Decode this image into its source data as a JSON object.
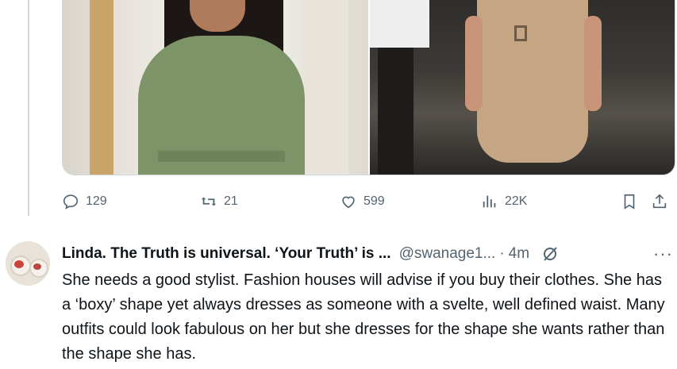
{
  "media": {
    "images": [
      {
        "icon": "woman-in-green-shirt-dress-photo"
      },
      {
        "icon": "woman-in-beige-trench-dress-photo"
      }
    ]
  },
  "actions": {
    "replies": "129",
    "reposts": "21",
    "likes": "599",
    "views": "22K"
  },
  "reply": {
    "display_name": "Linda. The Truth is universal. ‘Your Truth’ is ...",
    "handle": "@swanage1...",
    "separator": "·",
    "time": "4m",
    "more": "···",
    "text": "She needs a good stylist. Fashion houses will advise if you buy their clothes. She has a ‘boxy’ shape yet always dresses as someone with a svelte, well defined waist. Many outfits could look fabulous on her but she dresses for the shape she wants rather than the shape she has."
  },
  "colors": {
    "text": "#0f1419",
    "secondary": "#536471",
    "border": "#cfd9de"
  }
}
